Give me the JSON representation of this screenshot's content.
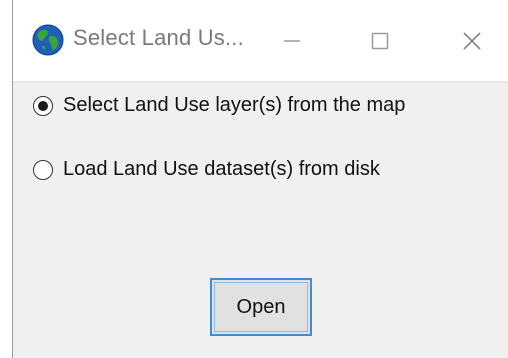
{
  "window": {
    "title": "Select Land Us...",
    "icon": "globe-icon",
    "controls": {
      "minimize_icon": "minimize-icon",
      "maximize_icon": "maximize-icon",
      "close_icon": "close-icon"
    }
  },
  "options": [
    {
      "label": "Select Land Use layer(s) from the map",
      "selected": true
    },
    {
      "label": "Load Land Use dataset(s) from disk",
      "selected": false
    }
  ],
  "buttons": {
    "open_label": "Open"
  },
  "colors": {
    "button_focus_border": "#3c8fd6",
    "window_background": "#f0f0f0",
    "titlebar_background": "#ffffff",
    "globe_ocean": "#1f5fb5",
    "globe_land": "#3aa53a"
  }
}
